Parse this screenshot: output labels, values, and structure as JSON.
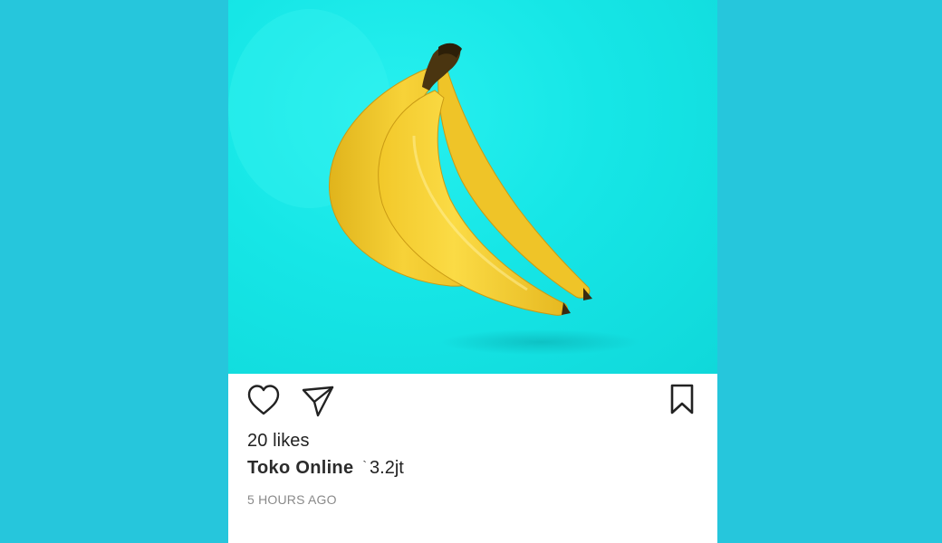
{
  "post": {
    "image_subject": "Bunch of yellow bananas on a cyan background",
    "likes_label": "20 likes",
    "caption_username": "Toko Online",
    "caption_tick": "`",
    "caption_text": "3.2jt",
    "timestamp": "5 HOURS AGO"
  },
  "icons": {
    "like": "heart-outline-icon",
    "share": "paper-plane-icon",
    "save": "bookmark-outline-icon"
  },
  "colors": {
    "page_background": "#26c6dc",
    "image_background": "#16e6e6",
    "banana": "#f5cf2e",
    "text": "#222222",
    "timestamp": "#8a8a8a"
  }
}
